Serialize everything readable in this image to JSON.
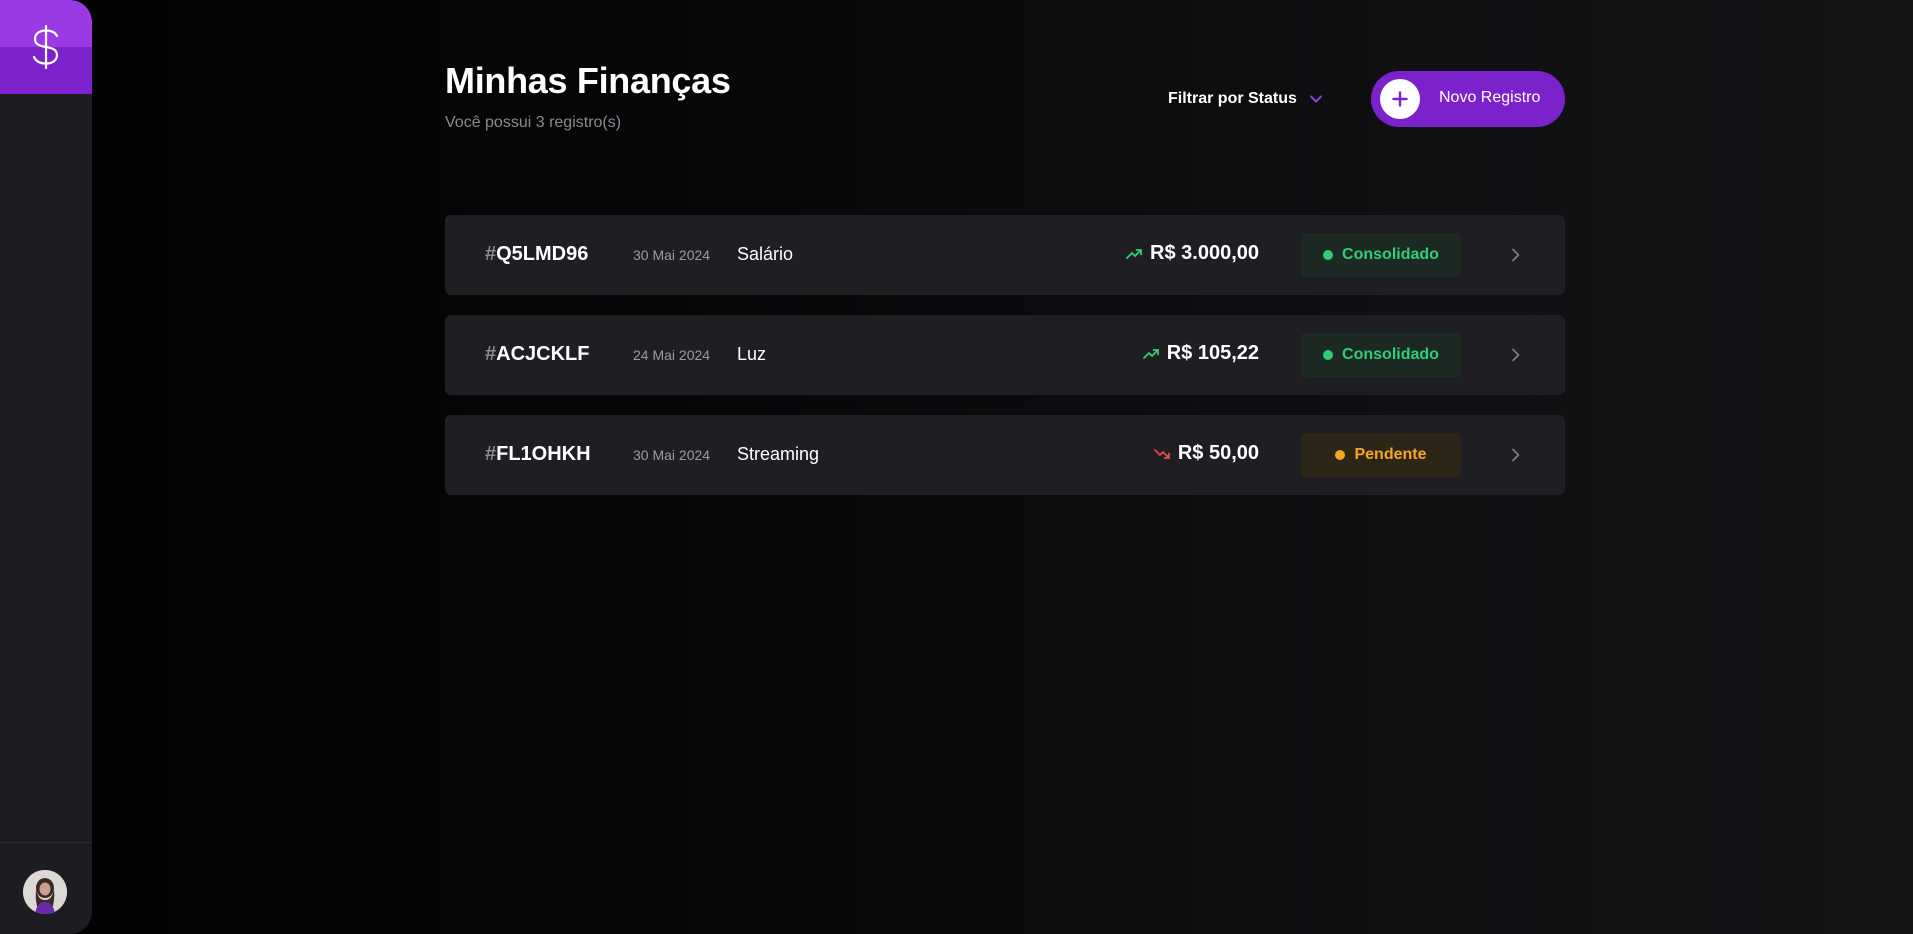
{
  "header": {
    "title": "Minhas Finanças",
    "subtitle": "Você possui 3 registro(s)"
  },
  "filter": {
    "label": "Filtrar por Status",
    "icon": "chevron-down-icon"
  },
  "new_button": {
    "label": "Novo Registro",
    "icon": "plus-icon"
  },
  "sidebar": {
    "logo_icon": "dollar-icon",
    "avatar": "user-avatar"
  },
  "colors": {
    "accent": "#7c22cc",
    "accent_light": "#9a3ae6",
    "success": "#33cc77",
    "warning": "#f5a623",
    "danger": "#e5484d"
  },
  "records": [
    {
      "hash": "#",
      "code": "Q5LMD96",
      "date": "30 Mai 2024",
      "description": "Salário",
      "amount": "R$ 3.000,00",
      "trend": "trend-up-icon",
      "status": "Consolidado"
    },
    {
      "hash": "#",
      "code": "ACJCKLF",
      "date": "24 Mai 2024",
      "description": "Luz",
      "amount": "R$ 105,22",
      "trend": "trend-up-icon",
      "status": "Consolidado"
    },
    {
      "hash": "#",
      "code": "FL1OHKH",
      "date": "30 Mai 2024",
      "description": "Streaming",
      "amount": "R$ 50,00",
      "trend": "trend-down-icon",
      "status": "Pendente"
    }
  ]
}
